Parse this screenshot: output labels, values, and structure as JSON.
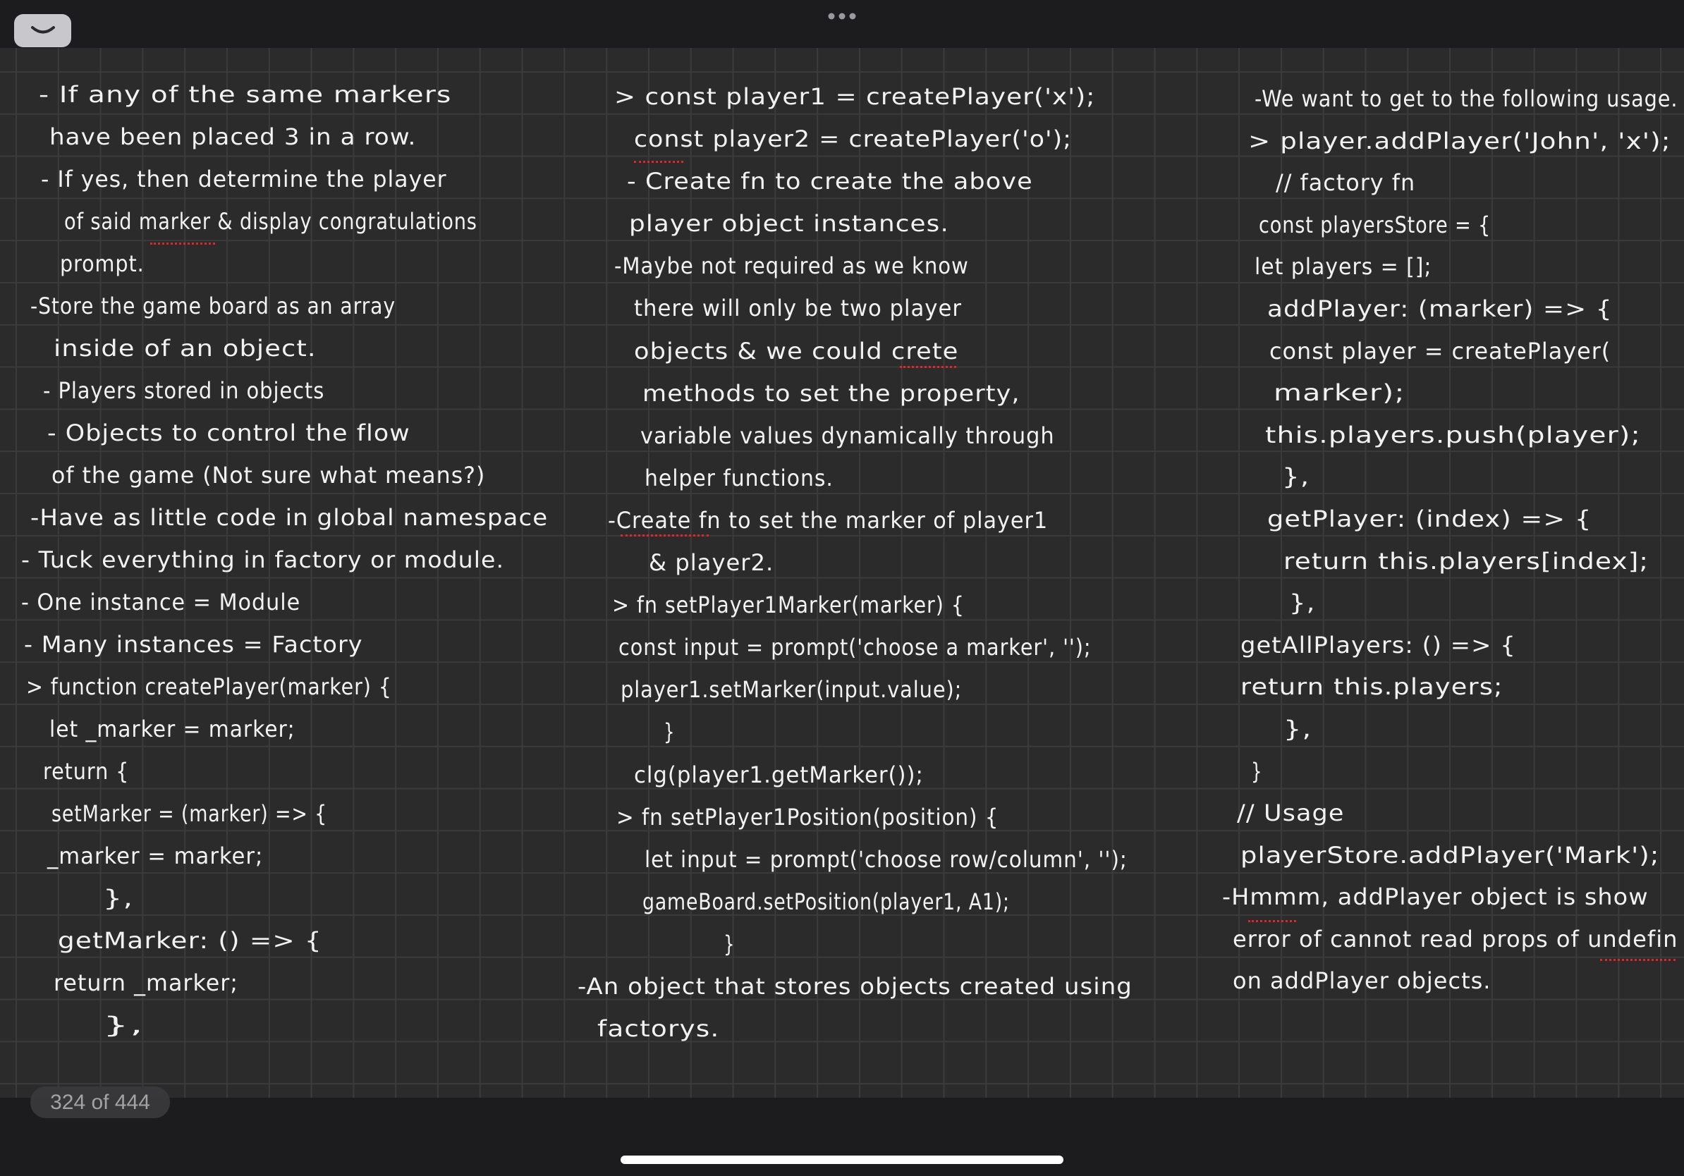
{
  "toolbar": {
    "collapse_button_icon": "chevron-down-icon",
    "more_menu_icon": "ellipsis-icon"
  },
  "colors": {
    "chrome": "#1c1c1e",
    "paper": "#2b2b2b",
    "grid": "#3b3b3b",
    "ink": "#f2f2f2",
    "spellcheck": "#e0262b",
    "indicator_text": "#a3a3a3"
  },
  "page": {
    "columns": [
      {
        "lines": [
          "- If any of the same markers",
          "have been placed 3 in a row.",
          "- If yes, then determine the player",
          "of said marker & display congratulations",
          "prompt.",
          "-Store the game board as an array",
          "inside of an object.",
          "- Players stored in objects",
          "- Objects to control the flow",
          "of the game (Not sure what means?)",
          "-Have as little code in global namespace",
          "- Tuck everything in factory or module.",
          "- One instance = Module",
          "- Many instances = Factory",
          "> function createPlayer(marker) {",
          "let _marker = marker;",
          "return {",
          "setMarker = (marker) => {",
          "_marker = marker;",
          "},",
          "getMarker: () => {",
          "return _marker;",
          "},"
        ]
      },
      {
        "lines": [
          "> const player1 = createPlayer('x');",
          "const player2 = createPlayer('o');",
          "- Create fn to create the above",
          "player object instances.",
          "-Maybe not required as we know",
          "there will only be two player",
          "objects & we could crete",
          "methods to set the property,",
          "variable values dynamically through",
          "helper functions.",
          "-Create fn to set the marker of player1",
          "& player2.",
          "> fn setPlayer1Marker(marker) {",
          "const input = prompt('choose a marker', '');",
          "player1.setMarker(input.value);",
          "}",
          "clg(player1.getMarker());",
          "> fn setPlayer1Position(position) {",
          "let input = prompt('choose row/column', '');",
          "gameBoard.setPosition(player1, A1);",
          "}",
          "-An object that stores objects created using",
          "factorys."
        ]
      },
      {
        "lines": [
          "-We want to get to the following usage.",
          "> player.addPlayer('John', 'x');",
          "// factory fn",
          "const playersStore = {",
          "let players = [];",
          "addPlayer: (marker) => {",
          "const player = createPlayer(",
          "marker);",
          "this.players.push(player);",
          "},",
          "getPlayer: (index) => {",
          "return this.players[index];",
          "},",
          "getAllPlayers: () => {",
          "return this.players;",
          "},",
          "}",
          "// Usage",
          "playerStore.addPlayer('Mark');",
          "-Hmmm, addPlayer object is show",
          "error of cannot read props of undefin",
          "on addPlayer objects."
        ]
      }
    ]
  },
  "page_indicator": "324 of 444"
}
